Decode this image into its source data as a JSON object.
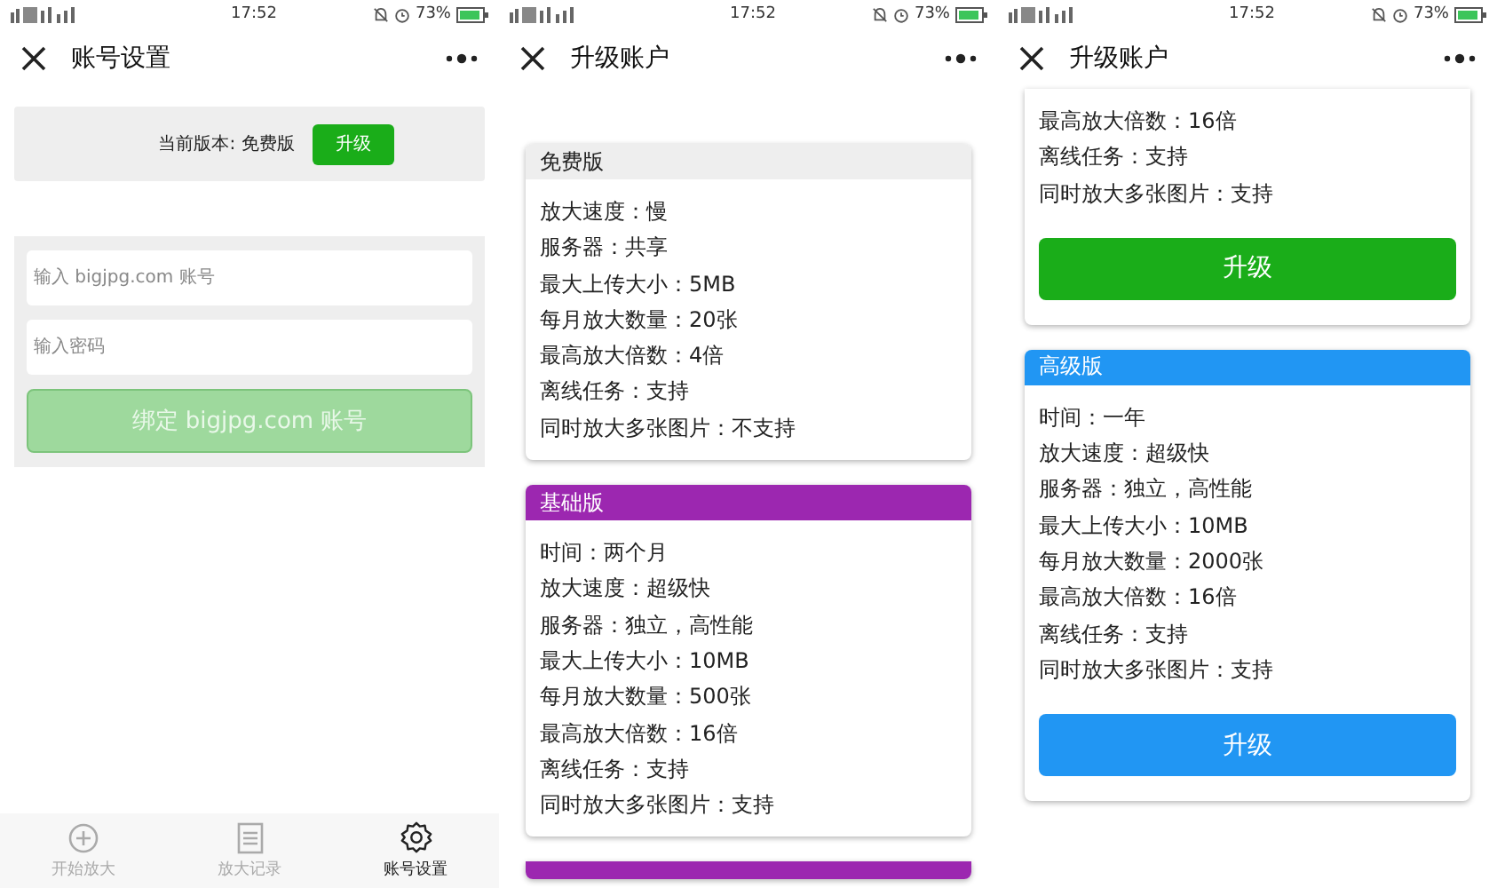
{
  "screens": [
    {
      "kind": "settings",
      "status_bar": {
        "time": "17:52",
        "battery": "73%"
      },
      "header": {
        "title": "账号设置"
      },
      "version_label": "当前版本: 免费版",
      "upgrade_button": "升级",
      "account_field": {
        "placeholder": "输入 bigjpg.com 账号"
      },
      "password_field": {
        "placeholder": "输入密码"
      },
      "bind_button": {
        "label": "绑定 bigjpg.com 账号",
        "disabled": true
      },
      "tab_bar": [
        {
          "kind": "add",
          "label": "开始放大",
          "selected": false
        },
        {
          "kind": "list",
          "label": "放大记录",
          "selected": false
        },
        {
          "kind": "gear",
          "label": "账号设置",
          "selected": true
        }
      ]
    },
    {
      "kind": "plans",
      "status_bar": {
        "time": "17:52",
        "battery": "73%"
      },
      "header": {
        "title": "升级账户"
      },
      "plans": [
        {
          "name": "免费版",
          "color": "#eeeeee",
          "lines": [
            "放大速度：慢",
            "服务器：共享",
            "最大上传大小：5MB",
            "每月放大数量：20张",
            "最高放大倍数：4倍",
            "离线任务：支持",
            "同时放大多张图片：不支持"
          ]
        },
        {
          "name": "基础版",
          "color": "#9c27b0",
          "lines": [
            "时间：两个月",
            "放大速度：超级快",
            "服务器：独立，高性能",
            "最大上传大小：10MB",
            "每月放大数量：500张",
            "最高放大倍数：16倍",
            "离线任务：支持",
            "同时放大多张图片：支持"
          ]
        },
        {
          "color": "#9c27b0"
        }
      ]
    },
    {
      "kind": "plans",
      "status_bar": {
        "time": "17:52",
        "battery": "73%"
      },
      "header": {
        "title": "升级账户"
      },
      "plans": [
        {
          "lines": [
            "最高放大倍数：16倍",
            "离线任务：支持",
            "同时放大多张图片：支持"
          ],
          "button": {
            "label": "升级",
            "color": "#1aad19"
          }
        },
        {
          "name": "高级版",
          "color": "#2196f3",
          "lines": [
            "时间：一年",
            "放大速度：超级快",
            "服务器：独立，高性能",
            "最大上传大小：10MB",
            "每月放大数量：2000张",
            "最高放大倍数：16倍",
            "离线任务：支持",
            "同时放大多张图片：支持"
          ],
          "button": {
            "label": "升级",
            "color": "#2196f3"
          }
        }
      ]
    }
  ]
}
